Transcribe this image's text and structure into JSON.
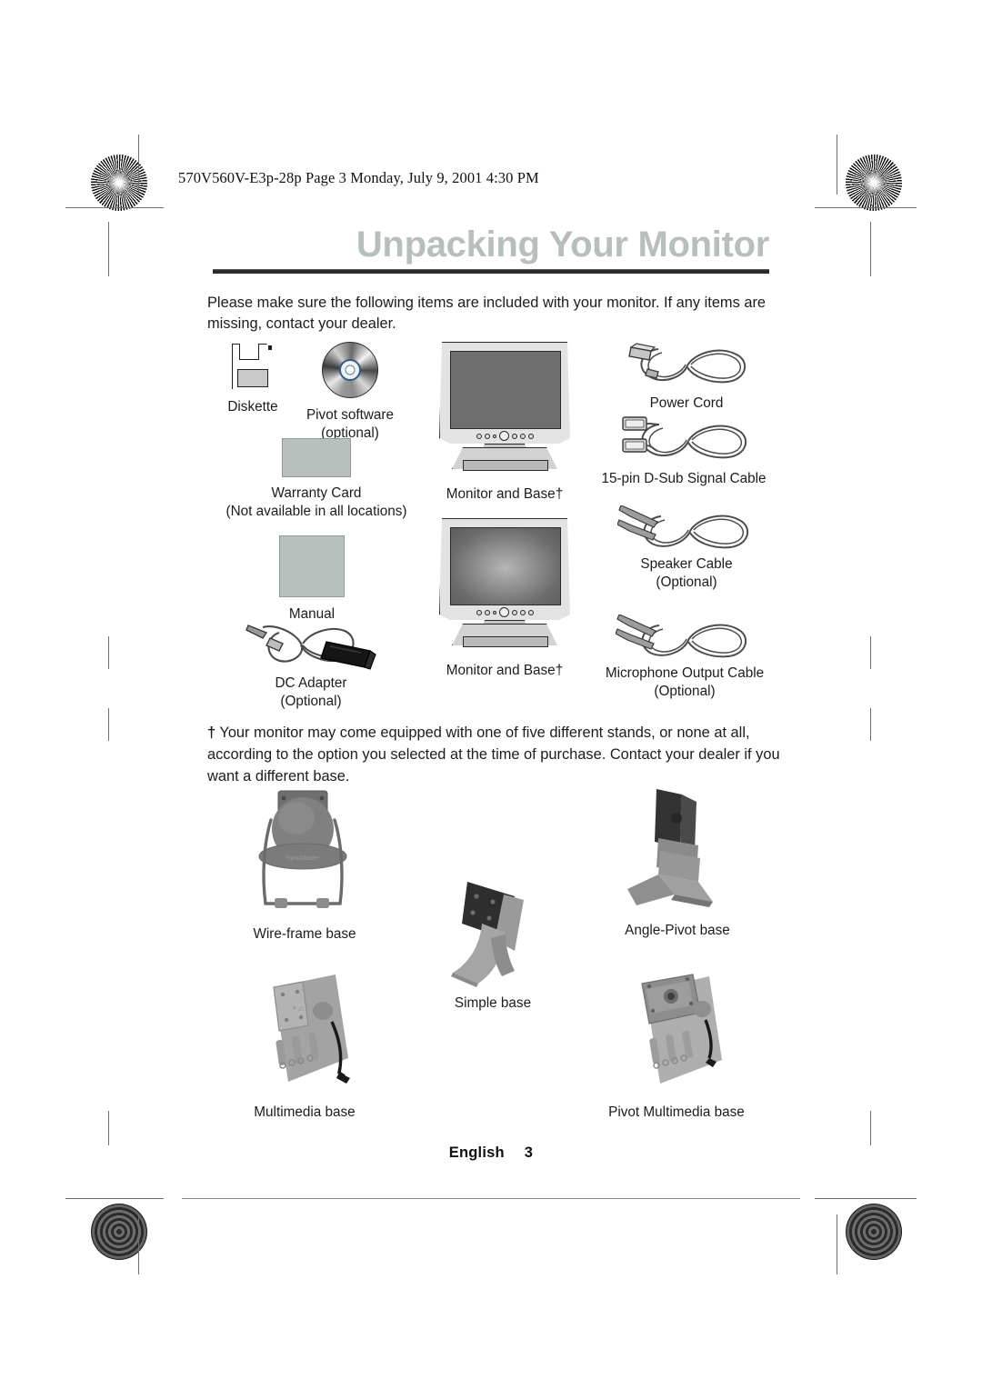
{
  "print_slug": "570V560V-E3p-28p  Page 3  Monday, July 9, 2001  4:30 PM",
  "page": {
    "title": "Unpacking Your Monitor",
    "title_color": "#b6bfba",
    "intro": "Please make sure the following items are included with your monitor. If any items are missing, contact your dealer.",
    "footnote": "Your monitor may come equipped with one of five different stands, or none at all, according to the option you selected at the time of purchase. Contact your dealer if you want a different base.",
    "footnote_marker": "†"
  },
  "items": {
    "diskette": {
      "label": "Diskette"
    },
    "pivot_software": {
      "label": "Pivot software",
      "sub": "(optional)"
    },
    "warranty_card": {
      "label": "Warranty Card",
      "sub": "(Not available in all locations)"
    },
    "manual": {
      "label": "Manual"
    },
    "dc_adapter": {
      "label": "DC Adapter",
      "sub": "(Optional)"
    },
    "monitor_base_1": {
      "label": "Monitor and Base†"
    },
    "monitor_base_2": {
      "label": "Monitor and Base†"
    },
    "power_cord": {
      "label": "Power Cord"
    },
    "signal_cable": {
      "label": "15-pin D-Sub Signal Cable"
    },
    "speaker_cable": {
      "label": "Speaker Cable",
      "sub": "(Optional)"
    },
    "microphone_cable": {
      "label": "Microphone Output Cable",
      "sub": "(Optional)"
    }
  },
  "bases": {
    "wire_frame": {
      "label": "Wire-frame base"
    },
    "simple": {
      "label": "Simple base"
    },
    "angle_pivot": {
      "label": "Angle-Pivot base"
    },
    "multimedia": {
      "label": "Multimedia base"
    },
    "pivot_multimedia": {
      "label": "Pivot Multimedia base"
    }
  },
  "footer": {
    "language": "English",
    "page_number": "3"
  }
}
